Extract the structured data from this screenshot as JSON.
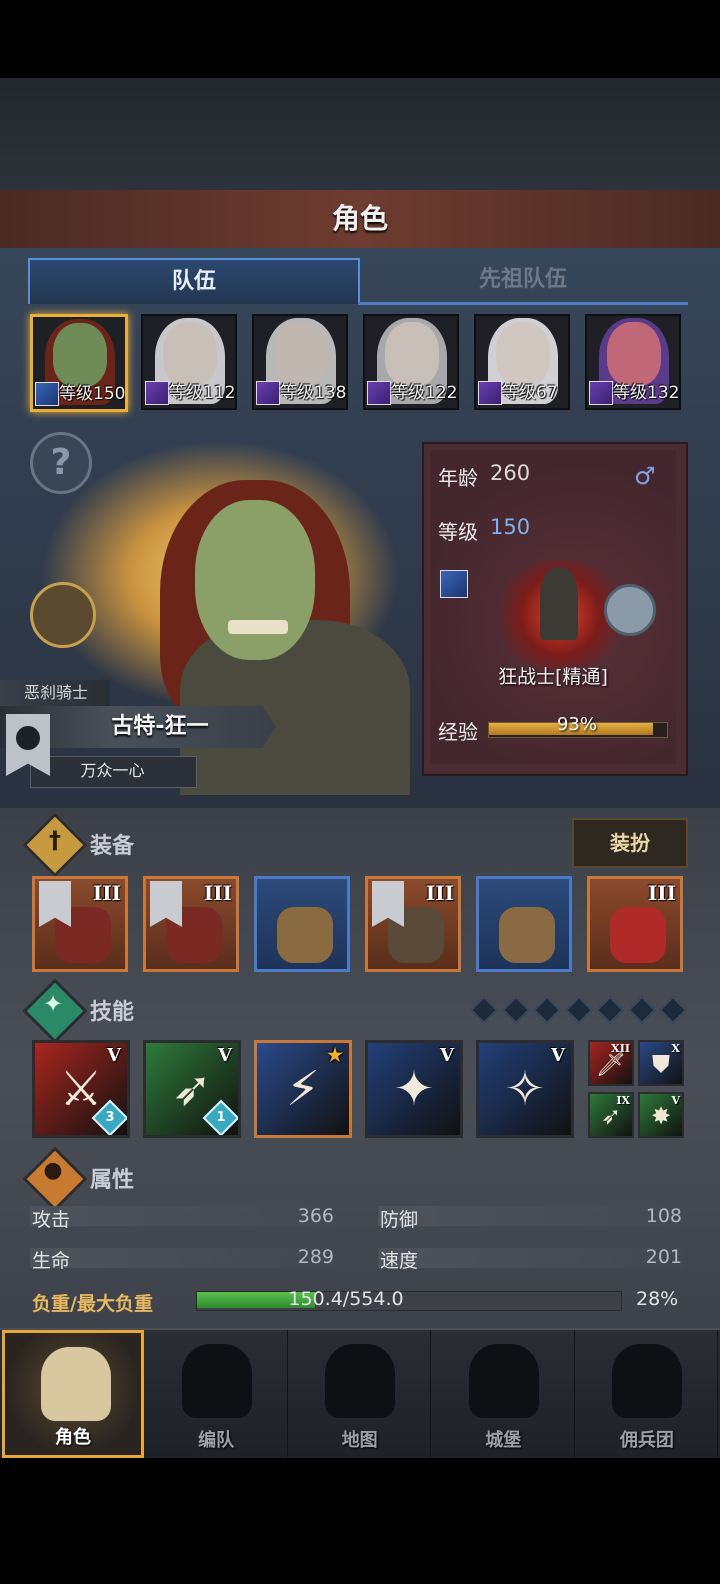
{
  "header": {
    "title": "角色"
  },
  "tabs": [
    {
      "label": "队伍",
      "active": true
    },
    {
      "label": "先祖队伍",
      "active": false
    }
  ],
  "roster": [
    {
      "level": "等级150",
      "gem": "blue",
      "selected": true,
      "skin": "#6f8c58",
      "hair": "#6a2418"
    },
    {
      "level": "等级112",
      "gem": "purple",
      "selected": false,
      "skin": "#c8c0b8",
      "hair": "#c8c8cc"
    },
    {
      "level": "等级138",
      "gem": "purple",
      "selected": false,
      "skin": "#c0b8b0",
      "hair": "#b8b8b8"
    },
    {
      "level": "等级122",
      "gem": "purple",
      "selected": false,
      "skin": "#c8c0b8",
      "hair": "#a8a8ac"
    },
    {
      "level": "等级67",
      "gem": "purple",
      "selected": false,
      "skin": "#d0c8c0",
      "hair": "#d0d0d4"
    },
    {
      "level": "等级132",
      "gem": "purple",
      "selected": false,
      "skin": "#c06878",
      "hair": "#5a3a8a"
    }
  ],
  "hero": {
    "class_tag": "恶刹骑士",
    "name": "古特-狂一",
    "title": "万众一心"
  },
  "info": {
    "age_label": "年龄",
    "age": "260",
    "level_label": "等级",
    "level": "150",
    "gender_icon": "male-icon",
    "class_name": "狂战士[精通]",
    "exp_label": "经验",
    "exp_text": "93%",
    "exp_fraction": 0.93
  },
  "equipment": {
    "label": "装备",
    "dress_button": "装扮",
    "slots": [
      {
        "tier": "III",
        "banner": true,
        "color": "orange",
        "item": "#7a2a22"
      },
      {
        "tier": "III",
        "banner": true,
        "color": "orange",
        "item": "#7a2a22"
      },
      {
        "tier": "",
        "banner": false,
        "color": "blue",
        "item": "#8a6a40"
      },
      {
        "tier": "III",
        "banner": true,
        "color": "orange",
        "item": "#5a4a3a"
      },
      {
        "tier": "",
        "banner": false,
        "color": "blue",
        "item": "#8a6a44"
      },
      {
        "tier": "III",
        "banner": false,
        "color": "orange",
        "item": "#b02a2a"
      }
    ]
  },
  "skills": {
    "label": "技能",
    "items": [
      {
        "tier": "V",
        "badge": "3",
        "bg": "#a8261e",
        "glyph": "⚔",
        "border": "#2a2c30"
      },
      {
        "tier": "V",
        "badge": "1",
        "bg": "#2e7a3a",
        "glyph": "➶",
        "border": "#2a2c30"
      },
      {
        "tier": "★",
        "badge": "",
        "bg": "#2a4a8a",
        "glyph": "⚡",
        "border": "#c8783a"
      },
      {
        "tier": "V",
        "badge": "",
        "bg": "#22407a",
        "glyph": "✦",
        "border": "#2a2c30"
      },
      {
        "tier": "V",
        "badge": "",
        "bg": "#22407a",
        "glyph": "✧",
        "border": "#2a2c30"
      }
    ],
    "mini": [
      {
        "tier": "XII",
        "bg": "#a8261e",
        "glyph": "🗡"
      },
      {
        "tier": "X",
        "bg": "#2a4a8a",
        "glyph": "⛊"
      },
      {
        "tier": "IX",
        "bg": "#2e7a3a",
        "glyph": "➶"
      },
      {
        "tier": "V",
        "bg": "#2e7a3a",
        "glyph": "✸"
      }
    ]
  },
  "attributes": {
    "label": "属性",
    "stats": [
      {
        "name": "攻击",
        "value": "366"
      },
      {
        "name": "防御",
        "value": "108"
      },
      {
        "name": "生命",
        "value": "289"
      },
      {
        "name": "速度",
        "value": "201"
      }
    ],
    "load_label": "负重/最大负重",
    "load_text": "150.4/554.0",
    "load_pct": "28%",
    "load_fraction": 0.28
  },
  "nav": [
    {
      "label": "角色",
      "active": true,
      "icon": "knight-icon"
    },
    {
      "label": "编队",
      "active": false,
      "icon": "helmet-icon"
    },
    {
      "label": "地图",
      "active": false,
      "icon": "compass-icon"
    },
    {
      "label": "城堡",
      "active": false,
      "icon": "castle-icon"
    },
    {
      "label": "佣兵团",
      "active": false,
      "icon": "mercenary-icon"
    }
  ],
  "colors": {
    "accent": "#e8b038",
    "tab_blue": "#5a8ed8",
    "exp_gold": "#e8b040",
    "load_green": "#5ac050"
  }
}
